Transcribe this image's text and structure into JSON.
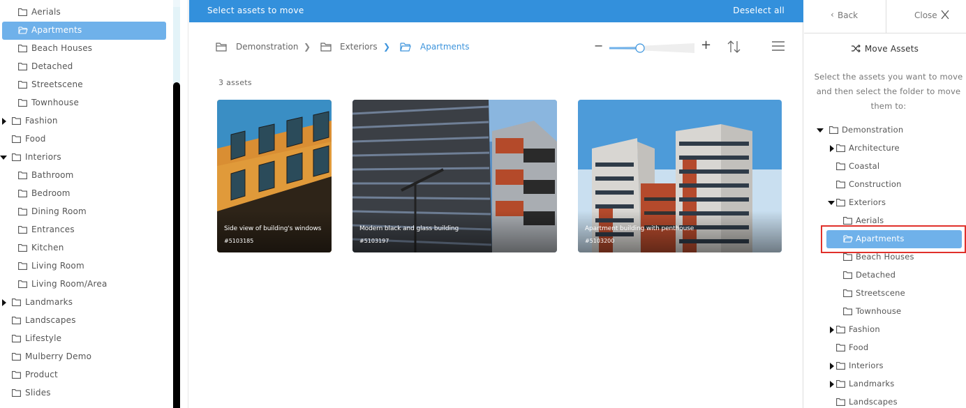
{
  "left_tree": [
    {
      "label": "Aerials",
      "level": 1,
      "caret": "",
      "selected": false
    },
    {
      "label": "Apartments",
      "level": 1,
      "caret": "",
      "selected": true
    },
    {
      "label": "Beach Houses",
      "level": 1,
      "caret": "",
      "selected": false
    },
    {
      "label": "Detached",
      "level": 1,
      "caret": "",
      "selected": false
    },
    {
      "label": "Streetscene",
      "level": 1,
      "caret": "",
      "selected": false
    },
    {
      "label": "Townhouse",
      "level": 1,
      "caret": "",
      "selected": false
    },
    {
      "label": "Fashion",
      "level": 0,
      "caret": "right",
      "selected": false
    },
    {
      "label": "Food",
      "level": 0,
      "caret": "",
      "selected": false
    },
    {
      "label": "Interiors",
      "level": 0,
      "caret": "down",
      "selected": false
    },
    {
      "label": "Bathroom",
      "level": 1,
      "caret": "",
      "selected": false
    },
    {
      "label": "Bedroom",
      "level": 1,
      "caret": "",
      "selected": false
    },
    {
      "label": "Dining Room",
      "level": 1,
      "caret": "",
      "selected": false
    },
    {
      "label": "Entrances",
      "level": 1,
      "caret": "",
      "selected": false
    },
    {
      "label": "Kitchen",
      "level": 1,
      "caret": "",
      "selected": false
    },
    {
      "label": "Living Room",
      "level": 1,
      "caret": "",
      "selected": false
    },
    {
      "label": "Living Room/Area",
      "level": 1,
      "caret": "",
      "selected": false
    },
    {
      "label": "Landmarks",
      "level": 0,
      "caret": "right",
      "selected": false
    },
    {
      "label": "Landscapes",
      "level": 0,
      "caret": "",
      "selected": false
    },
    {
      "label": "Lifestyle",
      "level": 0,
      "caret": "",
      "selected": false
    },
    {
      "label": "Mulberry Demo",
      "level": 0,
      "caret": "",
      "selected": false
    },
    {
      "label": "Product",
      "level": 0,
      "caret": "",
      "selected": false
    },
    {
      "label": "Slides",
      "level": 0,
      "caret": "",
      "selected": false
    }
  ],
  "topbar": {
    "title": "Select assets to move",
    "deselect_label": "Deselect all",
    "color": "#3390dc"
  },
  "breadcrumbs": [
    "Demonstration",
    "Exteriors",
    "Apartments"
  ],
  "zoom": {
    "level": 0.36
  },
  "asset_count": "3 assets",
  "assets": [
    {
      "caption": "Side view of building's windows",
      "id": "#5103185"
    },
    {
      "caption": "Modern black and glass building",
      "id": "#5103197"
    },
    {
      "caption": "Apartment building with penthouse",
      "id": "#5103200"
    }
  ],
  "right_panel": {
    "back_label": "Back",
    "close_label": "Close",
    "title": "Move Assets",
    "help_lines": [
      "Select the assets you want to move",
      "and then select the folder to move",
      "them to:"
    ],
    "tree": [
      {
        "label": "Demonstration",
        "level": 0,
        "caret": "down",
        "selected": false
      },
      {
        "label": "Architecture",
        "level": 1,
        "caret": "right",
        "selected": false
      },
      {
        "label": "Coastal",
        "level": 1,
        "caret": "",
        "selected": false
      },
      {
        "label": "Construction",
        "level": 1,
        "caret": "",
        "selected": false
      },
      {
        "label": "Exteriors",
        "level": 1,
        "caret": "down",
        "selected": false
      },
      {
        "label": "Aerials",
        "level": 2,
        "caret": "",
        "selected": false
      },
      {
        "label": "Apartments",
        "level": 2,
        "caret": "",
        "selected": true
      },
      {
        "label": "Beach Houses",
        "level": 2,
        "caret": "",
        "selected": false
      },
      {
        "label": "Detached",
        "level": 2,
        "caret": "",
        "selected": false
      },
      {
        "label": "Streetscene",
        "level": 2,
        "caret": "",
        "selected": false
      },
      {
        "label": "Townhouse",
        "level": 2,
        "caret": "",
        "selected": false
      },
      {
        "label": "Fashion",
        "level": 1,
        "caret": "right",
        "selected": false
      },
      {
        "label": "Food",
        "level": 1,
        "caret": "",
        "selected": false
      },
      {
        "label": "Interiors",
        "level": 1,
        "caret": "right",
        "selected": false
      },
      {
        "label": "Landmarks",
        "level": 1,
        "caret": "right",
        "selected": false
      },
      {
        "label": "Landscapes",
        "level": 1,
        "caret": "",
        "selected": false
      }
    ]
  },
  "colors": {
    "accent": "#3390dc",
    "selected_row": "#6fb1ea",
    "highlight": "#e0302a"
  }
}
